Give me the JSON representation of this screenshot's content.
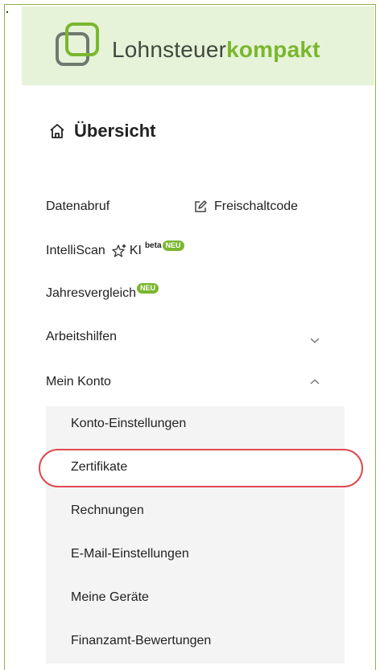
{
  "brand": {
    "name_part1": "Lohnsteuer",
    "name_part2": "kompakt",
    "icon": "logo-icon"
  },
  "overview": {
    "label": "Übersicht",
    "icon": "home-icon"
  },
  "nav": {
    "datenabruf": "Datenabruf",
    "freischaltcode": "Freischaltcode",
    "intelliscan": "IntelliScan",
    "ki": "KI",
    "beta": "beta",
    "neu": "NEU",
    "jahresvergleich": "Jahresvergleich",
    "arbeitshilfen": "Arbeitshilfen",
    "mein_konto": "Mein Konto"
  },
  "submenu": {
    "items": [
      {
        "label": "Konto-Einstellungen"
      },
      {
        "label": "Zertifikate"
      },
      {
        "label": "Rechnungen"
      },
      {
        "label": "E-Mail-Einstellungen"
      },
      {
        "label": "Meine Geräte"
      },
      {
        "label": "Finanzamt-Bewertungen"
      }
    ],
    "highlighted": "Zertifikate"
  },
  "colors": {
    "accent": "#7ab62f",
    "header_bg": "#e6f3d8",
    "highlight": "#e04950",
    "frame": "#8fb34f"
  }
}
